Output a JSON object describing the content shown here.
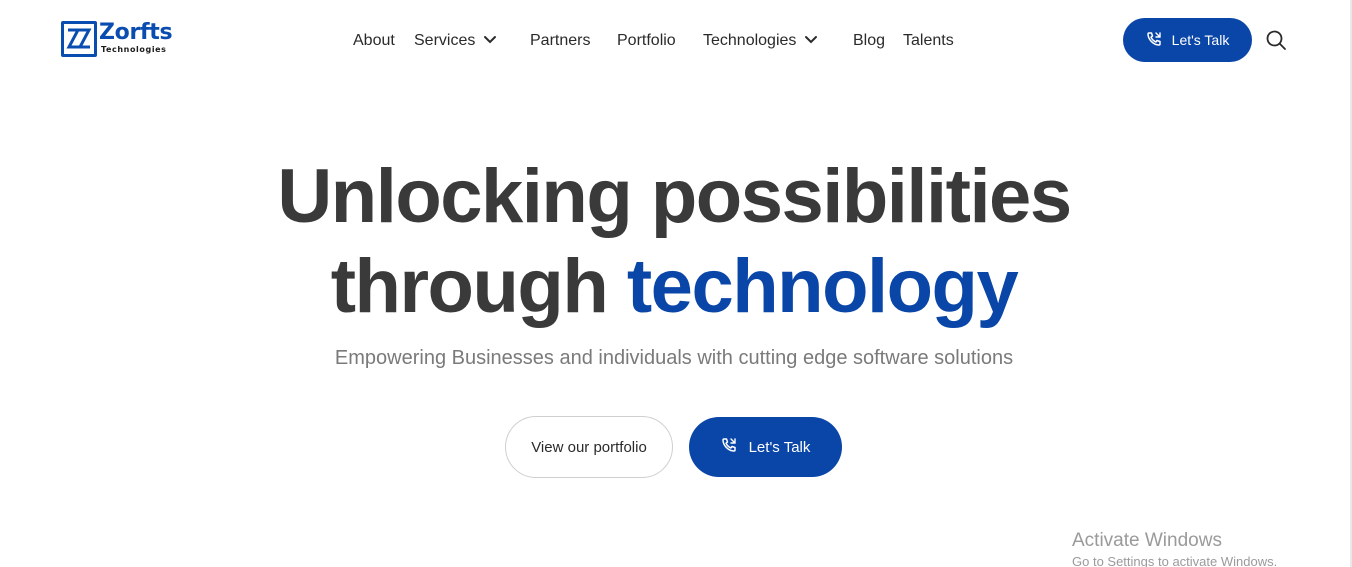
{
  "logo": {
    "name": "Zorfts",
    "tagline": "Technologies"
  },
  "nav": {
    "about": "About",
    "services": "Services",
    "partners": "Partners",
    "portfolio": "Portfolio",
    "technologies": "Technologies",
    "blog": "Blog",
    "talents": "Talents"
  },
  "header_cta": {
    "label": "Let's Talk",
    "icon": "phone-call-icon"
  },
  "search": {
    "icon": "search-icon"
  },
  "hero": {
    "title_line1": "Unlocking possibilities",
    "title_line2_plain": "through ",
    "title_line2_accent": "technology",
    "subtitle": "Empowering Businesses and individuals with cutting edge software solutions",
    "portfolio_button": "View our portfolio",
    "talk_button": "Let's Talk"
  },
  "watermark": {
    "title": "Activate Windows",
    "subtitle": "Go to Settings to activate Windows."
  },
  "colors": {
    "brand": "#0a46a8",
    "heading": "#3a3a3a",
    "subtitle": "#7a7a7a"
  }
}
